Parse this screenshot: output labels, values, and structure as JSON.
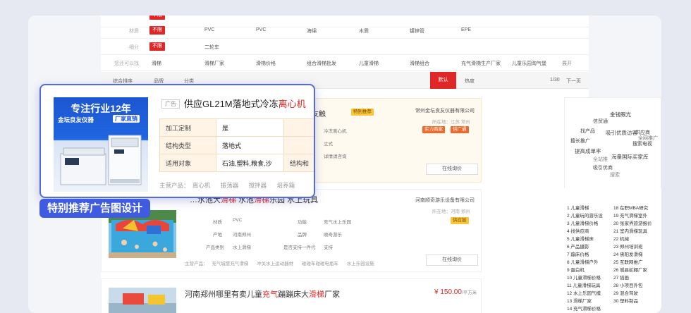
{
  "filters": [
    {
      "label": "材质",
      "tag": "不限",
      "options": [
        "PVC",
        "PVC",
        "海绵",
        "木质",
        "镀锌管",
        "EPE"
      ]
    },
    {
      "label": "细分",
      "tag": "不限",
      "options": [
        "二轮车"
      ]
    },
    {
      "label": "您还可以找",
      "tag": "",
      "options": [
        "滑梯",
        "滑梯厂家",
        "滑梯价格",
        "组合滑梯批发",
        "儿童滑梯",
        "滑梯组合",
        "充气滑梯生产厂家",
        "儿童乐园淘气堡"
      ],
      "more": "展开"
    }
  ],
  "sortbar": {
    "items": [
      "综合排序",
      "品牌",
      "分类"
    ],
    "selected": "默认",
    "popular": "热度",
    "page": "1/30",
    "next": "下一页"
  },
  "listing1": {
    "title_pre": "…坛良友触",
    "badge": "特别推荐",
    "company": "常州金坛良友仪器有限公司",
    "location": "所在地：江苏 常州",
    "badges": [
      "实力商家",
      "供广通"
    ],
    "attrs": [
      "冷冻离心机",
      "立式",
      "详情请咨询"
    ],
    "button": "在线询价"
  },
  "listing2": {
    "title_a": "…水池大",
    "title_hl1": "滑梯",
    "title_b": " 水池",
    "title_hl2": "滑梯",
    "title_c": "乐园 水上玩具",
    "company": "河南顺奇游乐设备有限公司",
    "location": "所在地：河南 郑州",
    "badge": "供应链",
    "attrs": [
      {
        "k": "材质",
        "v": "PVC",
        "k2": "功能",
        "v2": "充气水上乐园"
      },
      {
        "k": "产地",
        "v": "河南郑州",
        "k2": "品牌",
        "v2": "顺奇游乐"
      },
      {
        "k": "产品类别",
        "v": "水上滑梯",
        "k2": "是否支持一件代",
        "v2": "支持"
      }
    ],
    "products_label": "主营产品：",
    "products": [
      "充气城堡充气滑梯",
      "冲关水上运动器材",
      "碰碰车碰碰电瓶车",
      "水上乐园设施"
    ],
    "button": "在线询价"
  },
  "listing3": {
    "title_a": "河南郑州哪里有卖儿童",
    "title_hl1": "充气",
    "title_b": "蹦蹦床大",
    "title_hl2": "滑梯",
    "title_c": "厂家",
    "price": "¥ 150.00",
    "unit": "/平方米"
  },
  "cloud": [
    "信贸通",
    "金钱眼光",
    "找产品",
    "供应商",
    "搜索电视",
    "吸引优质访客",
    "擅长推广",
    "全网推广",
    "提高成单率",
    "全站推",
    "海量国际买家库",
    "吸引优商",
    "搜索"
  ],
  "ranks_left": [
    "1 儿童滑梯",
    "2 儿童玩的游乐设",
    "3 儿童滑梯价格",
    "4 找供应商",
    "5 儿童滑梯床",
    "6 产品摄影",
    "7 蹦床价格",
    "8 儿童滑梯户外",
    "9 蛋白机",
    "10 儿童滑梯价格",
    "11 儿童滑梯玩具",
    "12 水上乐园气模",
    "13 滑梯厂家",
    "14 充气滑梯价格"
  ],
  "ranks_right": [
    "18 在职MBA研究",
    "19 充气滑梯室外",
    "20 张家界旅游报价",
    "21 室内滑梯玩具",
    "22 机械",
    "23 郑州培训班",
    "24 佛阳发滑梯",
    "25 互联网推广",
    "26 城县蛇棚厂家",
    "27 插画",
    "28 小项目外包",
    "29 混合驾驶",
    "30 塑料制品",
    ""
  ],
  "ad": {
    "image_line1": "专注行业12年",
    "image_line2": "金坛良友仪器",
    "image_badge": "厂家直销",
    "tag": "广告",
    "title_main": "供应GL21M落地式冷冻",
    "title_hl": "离心机",
    "rows": [
      {
        "k": "加工定制",
        "v": "是"
      },
      {
        "k": "结构类型",
        "v": "落地式"
      },
      {
        "k": "适用对象",
        "v": "石油,塑料,粮食,沙",
        "k2": "结构和"
      }
    ],
    "main_label": "主营产品：",
    "main_products": [
      "离心机",
      "振荡器",
      "搅拌器",
      "培养箱"
    ]
  },
  "caption": "特别推荐广告图设计",
  "colors": {
    "accent": "#e02727",
    "frame_blue": "#5369e8",
    "caption_blue": "#3f5be0"
  }
}
